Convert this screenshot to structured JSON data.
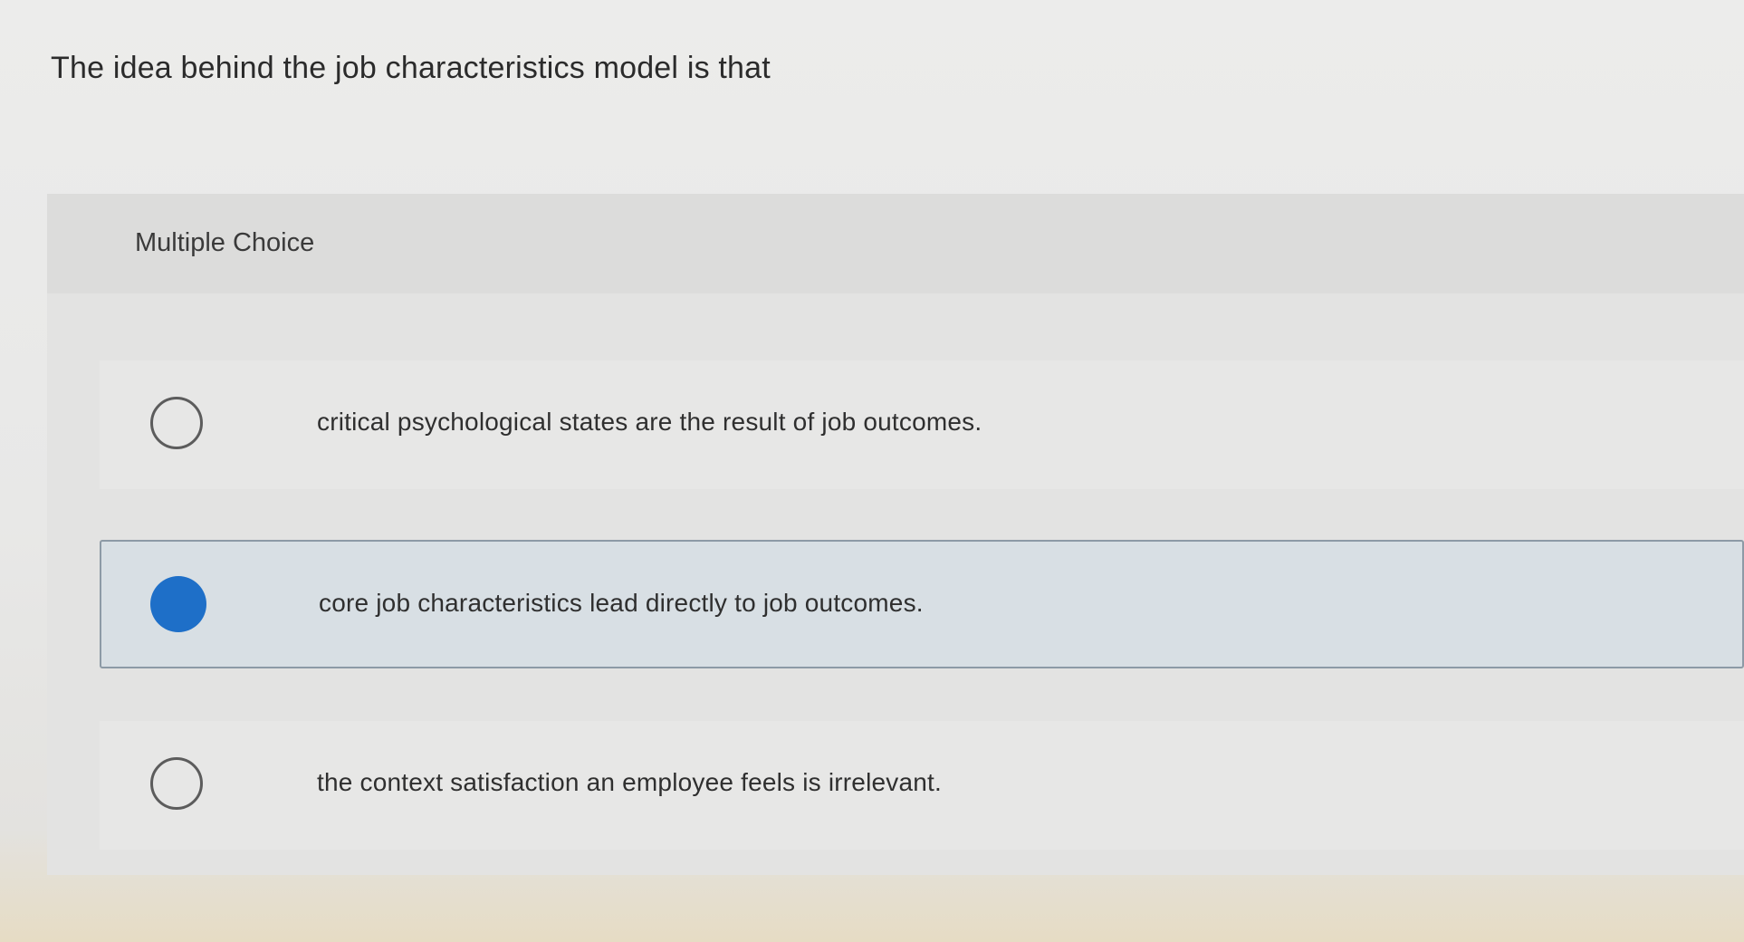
{
  "question": {
    "text": "The idea behind the job characteristics model is that"
  },
  "multiple_choice": {
    "header": "Multiple Choice",
    "options": [
      {
        "label": "critical psychological states are the result of job outcomes.",
        "selected": false
      },
      {
        "label": "core job characteristics lead directly to job outcomes.",
        "selected": true
      },
      {
        "label": "the context satisfaction an employee feels is irrelevant.",
        "selected": false
      }
    ]
  },
  "colors": {
    "selected_radio": "#1e6fc8",
    "selected_background": "#d8dfe4",
    "selected_border": "#8d9aa6"
  }
}
